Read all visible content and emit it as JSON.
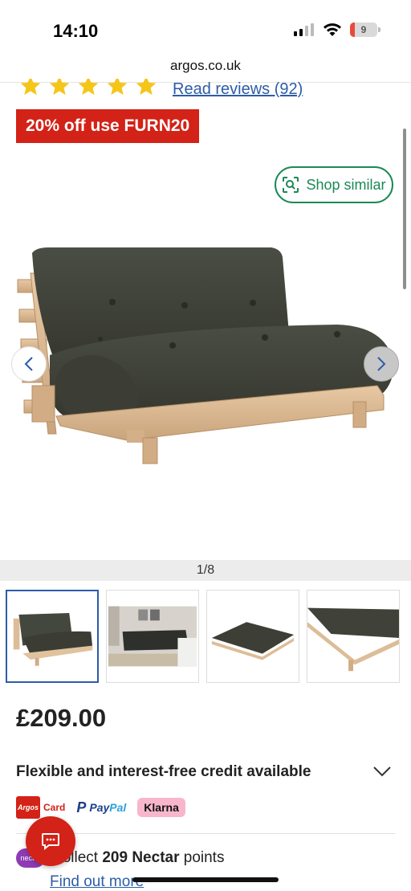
{
  "status_bar": {
    "time": "14:10",
    "battery": "9"
  },
  "browser": {
    "url": "argos.co.uk"
  },
  "rating": {
    "stars": 5,
    "reviews_link": "Read reviews (92)"
  },
  "promo": {
    "label": "20% off use FURN20"
  },
  "gallery": {
    "shop_similar_label": "Shop similar",
    "counter": "1/8"
  },
  "product": {
    "price": "£209.00"
  },
  "credit": {
    "label": "Flexible and interest-free credit available"
  },
  "payment_methods": {
    "argos_logo": "Argos",
    "argos_card_label": "Card",
    "paypal_label_1": "Pay",
    "paypal_label_2": "Pal",
    "klarna_label": "Klarna"
  },
  "nectar": {
    "logo": "nectar",
    "prefix": "Collect ",
    "points": "209 Nectar",
    "suffix": " points",
    "find_out_more": "Find out more"
  },
  "colors": {
    "brand_red": "#d32217",
    "link_blue": "#2d5ca8",
    "shop_similar_green": "#1a8a55",
    "star_yellow": "#f5c518"
  }
}
